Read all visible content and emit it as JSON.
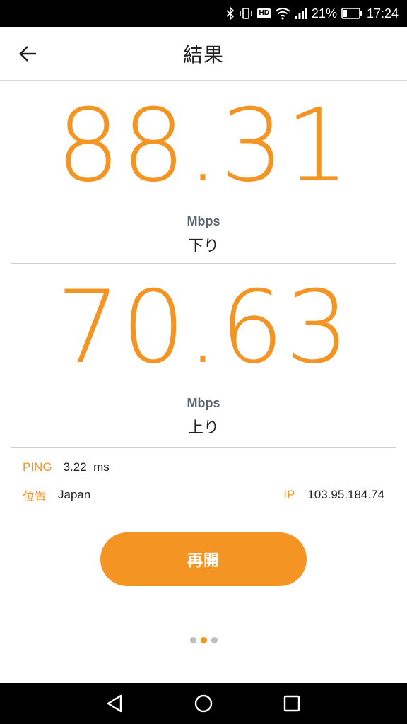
{
  "status_bar": {
    "icons": [
      "bluetooth-icon",
      "vibrate-icon",
      "hd-icon",
      "wifi-icon",
      "signal-icon"
    ],
    "hd_label": "HD",
    "battery_percent": "21%",
    "time": "17:24"
  },
  "app_bar": {
    "title": "結果",
    "back_icon": "arrow-left-icon"
  },
  "download": {
    "value": "88.31",
    "unit": "Mbps",
    "label": "下り"
  },
  "upload": {
    "value": "70.63",
    "unit": "Mbps",
    "label": "上り"
  },
  "info": {
    "ping_key": "PING",
    "ping_value": "3.22  ms",
    "location_key": "位置",
    "location_value": "Japan",
    "ip_key": "IP",
    "ip_value": "103.95.184.74"
  },
  "restart_button": {
    "label": "再開"
  },
  "page_indicator": {
    "count": 3,
    "active_index": 1
  },
  "nav_bar": {
    "icons": [
      "back-triangle-icon",
      "home-circle-icon",
      "recents-square-icon"
    ]
  },
  "colors": {
    "accent": "#f39423",
    "unit_text": "#5a6770",
    "divider": "#cfcfcf"
  }
}
